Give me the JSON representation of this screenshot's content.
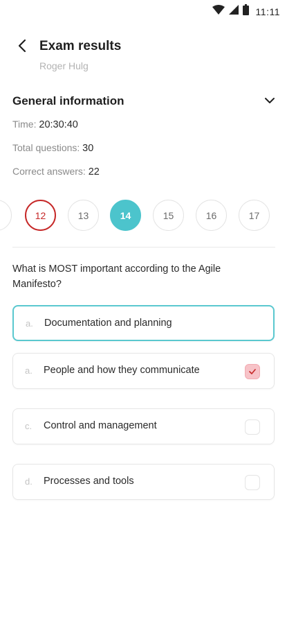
{
  "status_bar": {
    "time": "11:11"
  },
  "header": {
    "title": "Exam results",
    "subtitle": "Roger Hulg"
  },
  "general_info": {
    "title": "General information",
    "time_label": "Time: ",
    "time_value": "20:30:40",
    "total_label": "Total questions: ",
    "total_value": "30",
    "correct_label": "Correct answers: ",
    "correct_value": "22"
  },
  "question_pager": {
    "items": [
      {
        "number": "",
        "state": "default"
      },
      {
        "number": "12",
        "state": "wrong"
      },
      {
        "number": "13",
        "state": "default"
      },
      {
        "number": "14",
        "state": "active"
      },
      {
        "number": "15",
        "state": "default"
      },
      {
        "number": "16",
        "state": "default"
      },
      {
        "number": "17",
        "state": "default"
      }
    ]
  },
  "question": {
    "text": "What is MOST important according to the Agile Manifesto?",
    "answers": [
      {
        "letter": "a.",
        "text": "Documentation and planning",
        "selected": true,
        "checked": false,
        "has_checkbox": false
      },
      {
        "letter": "a.",
        "text": "People and how they communicate",
        "selected": false,
        "checked": true,
        "has_checkbox": true
      },
      {
        "letter": "c.",
        "text": "Control and management",
        "selected": false,
        "checked": false,
        "has_checkbox": true
      },
      {
        "letter": "d.",
        "text": "Processes and tools",
        "selected": false,
        "checked": false,
        "has_checkbox": true
      }
    ]
  },
  "colors": {
    "accent": "#4cc4cc",
    "wrong": "#c62828",
    "checked_fill": "#f7c3c8"
  }
}
